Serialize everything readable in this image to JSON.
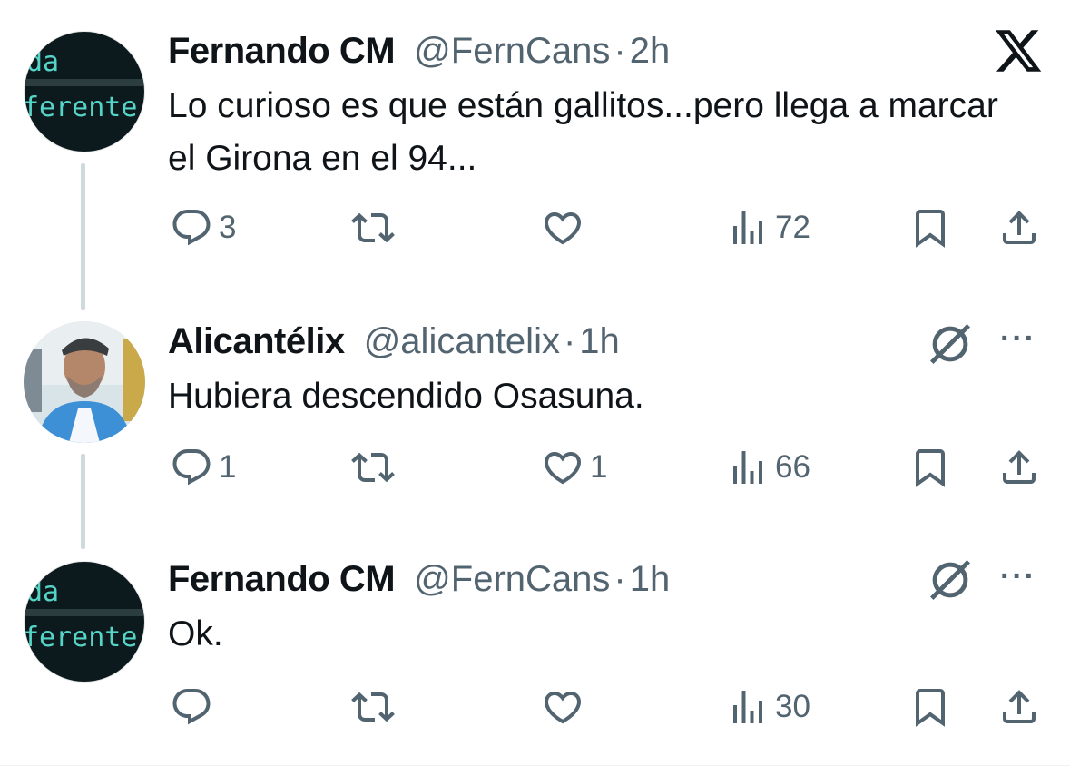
{
  "tweets": [
    {
      "name": "Fernando CM",
      "handle": "@FernCans",
      "separator": "·",
      "time": "2h",
      "text": "Lo curioso es que están gallitos...pero llega a marcar el Girona en el 94...",
      "avatar_text": [
        "da",
        "ferente"
      ],
      "replies": "3",
      "reposts": "",
      "likes": "",
      "views": "72",
      "top_icon": "x-logo-icon"
    },
    {
      "name": "Alicantélix",
      "handle": "@alicantelix",
      "separator": "·",
      "time": "1h",
      "text": "Hubiera descendido Osasuna.",
      "replies": "1",
      "reposts": "",
      "likes": "1",
      "views": "66",
      "top_icon": "grok-icon",
      "more": "···"
    },
    {
      "name": "Fernando CM",
      "handle": "@FernCans",
      "separator": "·",
      "time": "1h",
      "text": "Ok.",
      "avatar_text": [
        "da",
        "ferente"
      ],
      "replies": "",
      "reposts": "",
      "likes": "",
      "views": "30",
      "top_icon": "grok-icon",
      "more": "···"
    }
  ],
  "colors": {
    "text": "#0f1419",
    "secondary": "#536471",
    "thread_line": "#cfd9de",
    "avatar_logo_text": "#55d4c8"
  }
}
